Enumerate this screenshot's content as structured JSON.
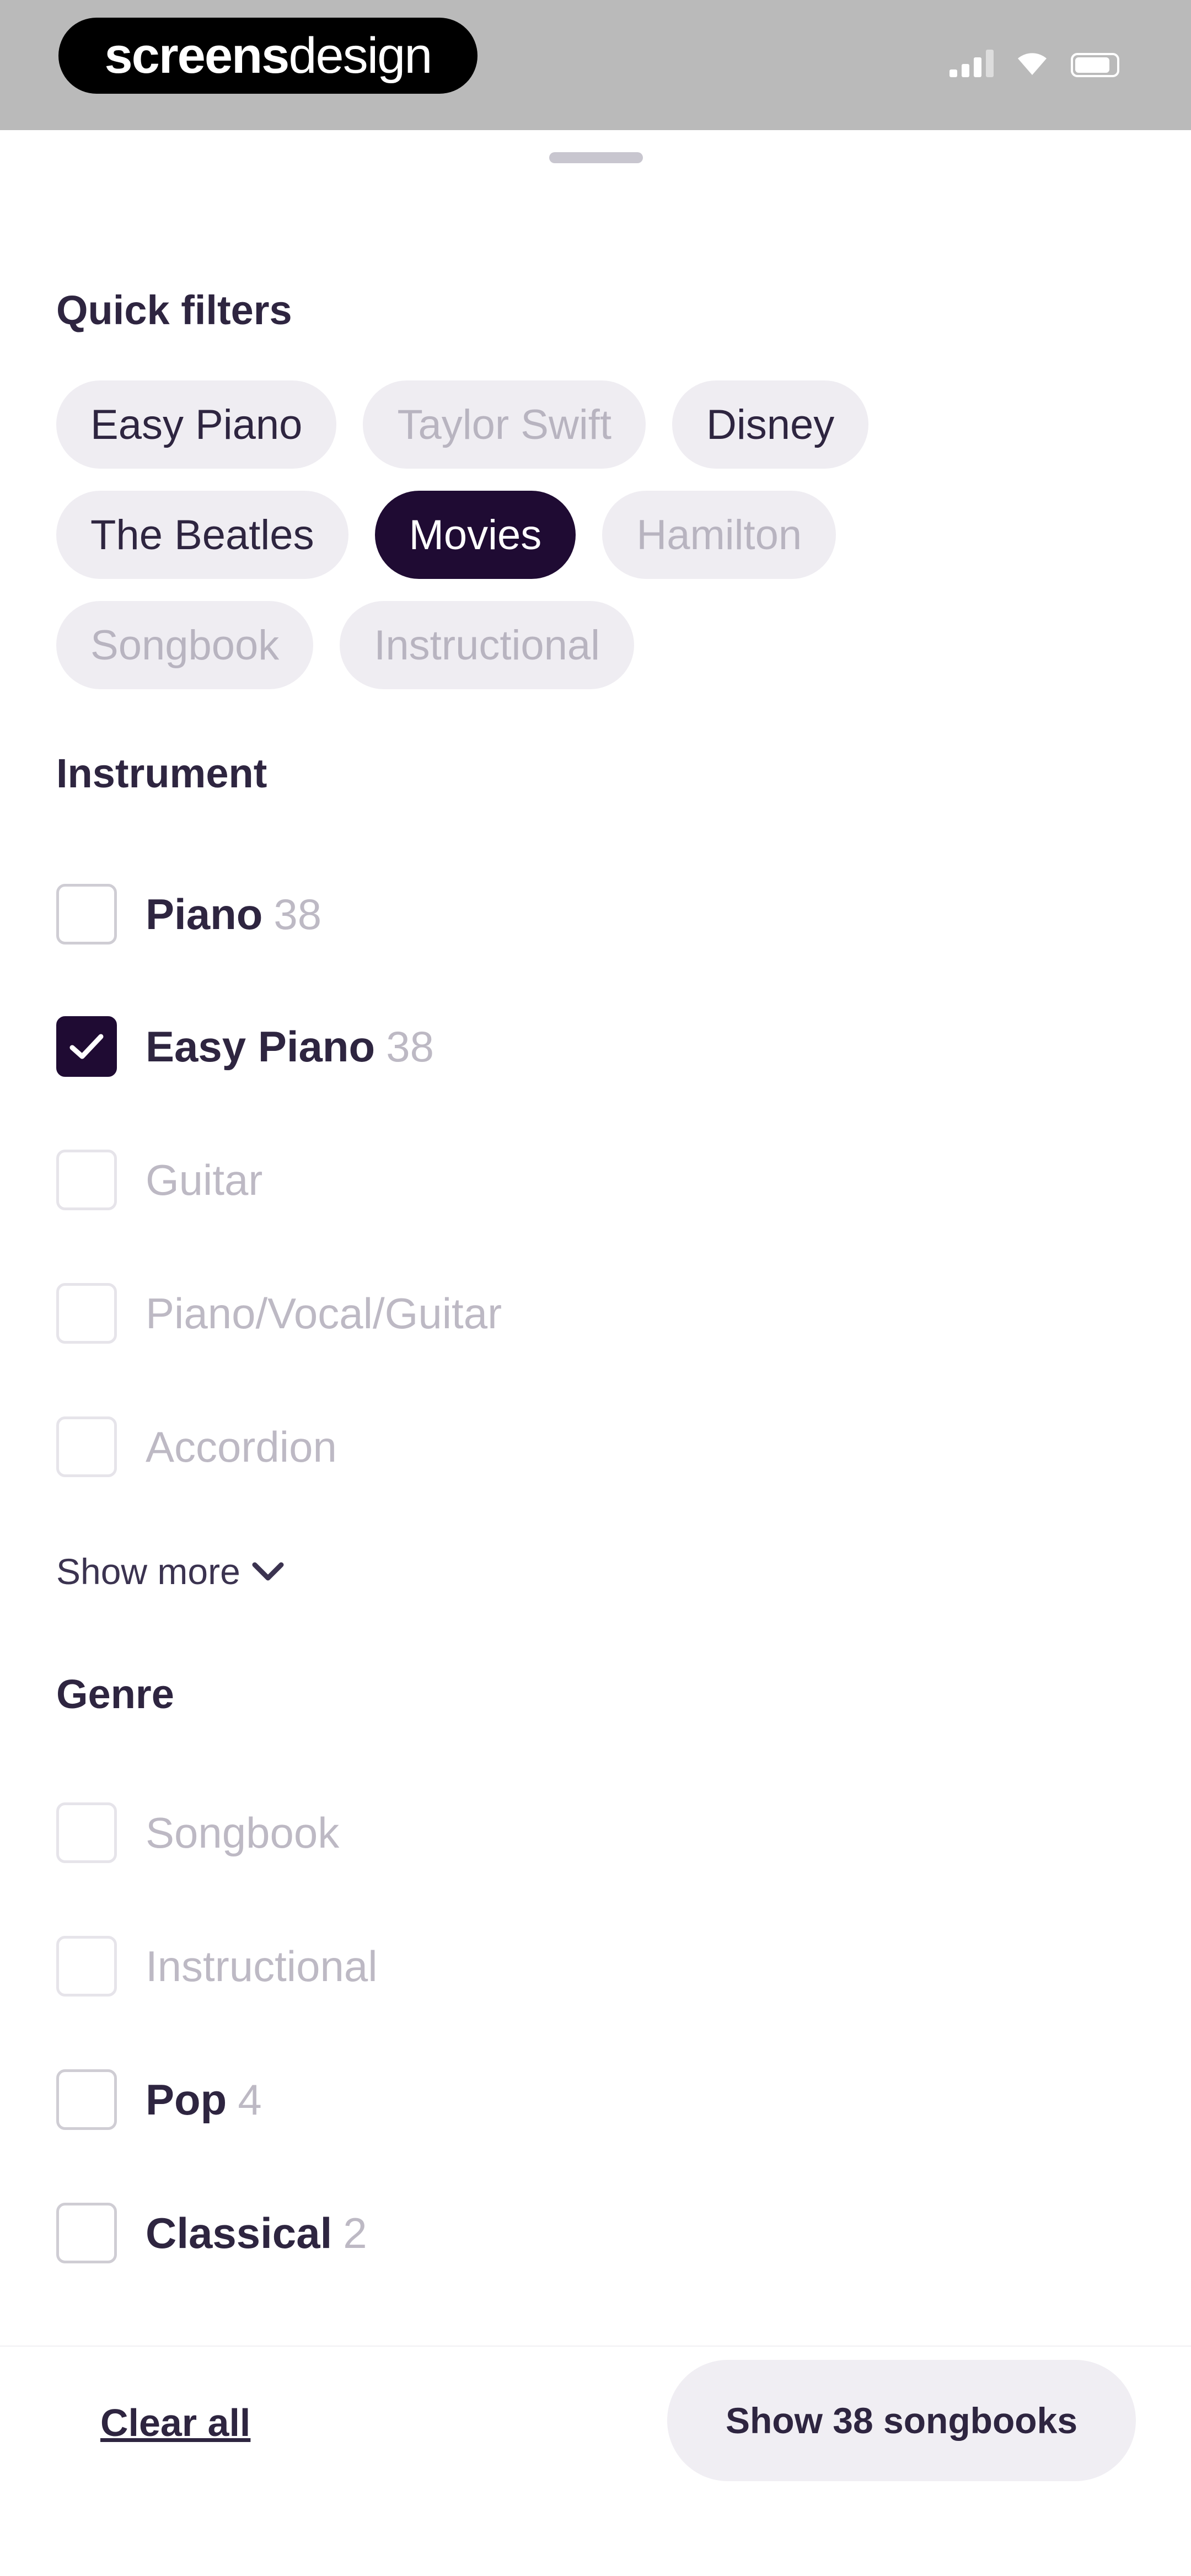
{
  "status_bar": {
    "brand_bold": "screens",
    "brand_light": "design"
  },
  "quick_filters": {
    "title": "Quick filters",
    "chips": [
      {
        "label": "Easy Piano",
        "state": "active"
      },
      {
        "label": "Taylor Swift",
        "state": "disabled"
      },
      {
        "label": "Disney",
        "state": "active"
      },
      {
        "label": "The Beatles",
        "state": "active"
      },
      {
        "label": "Movies",
        "state": "selected"
      },
      {
        "label": "Hamilton",
        "state": "disabled"
      },
      {
        "label": "Songbook",
        "state": "disabled"
      },
      {
        "label": "Instructional",
        "state": "disabled"
      }
    ]
  },
  "instrument": {
    "title": "Instrument",
    "options": [
      {
        "label": "Piano",
        "count": "38",
        "checked": false,
        "enabled": true
      },
      {
        "label": "Easy Piano",
        "count": "38",
        "checked": true,
        "enabled": true
      },
      {
        "label": "Guitar",
        "count": "",
        "checked": false,
        "enabled": false
      },
      {
        "label": "Piano/Vocal/Guitar",
        "count": "",
        "checked": false,
        "enabled": false
      },
      {
        "label": "Accordion",
        "count": "",
        "checked": false,
        "enabled": false
      }
    ],
    "show_more": "Show more"
  },
  "genre": {
    "title": "Genre",
    "options": [
      {
        "label": "Songbook",
        "count": "",
        "checked": false,
        "enabled": false
      },
      {
        "label": "Instructional",
        "count": "",
        "checked": false,
        "enabled": false
      },
      {
        "label": "Pop",
        "count": "4",
        "checked": false,
        "enabled": true
      },
      {
        "label": "Classical",
        "count": "2",
        "checked": false,
        "enabled": true
      }
    ]
  },
  "footer": {
    "clear_all": "Clear all",
    "primary": "Show 38 songbooks"
  },
  "colors": {
    "accent": "#1f0b33",
    "text": "#2e2540",
    "muted": "#bdb9c4",
    "chip_bg": "#efedf2"
  }
}
